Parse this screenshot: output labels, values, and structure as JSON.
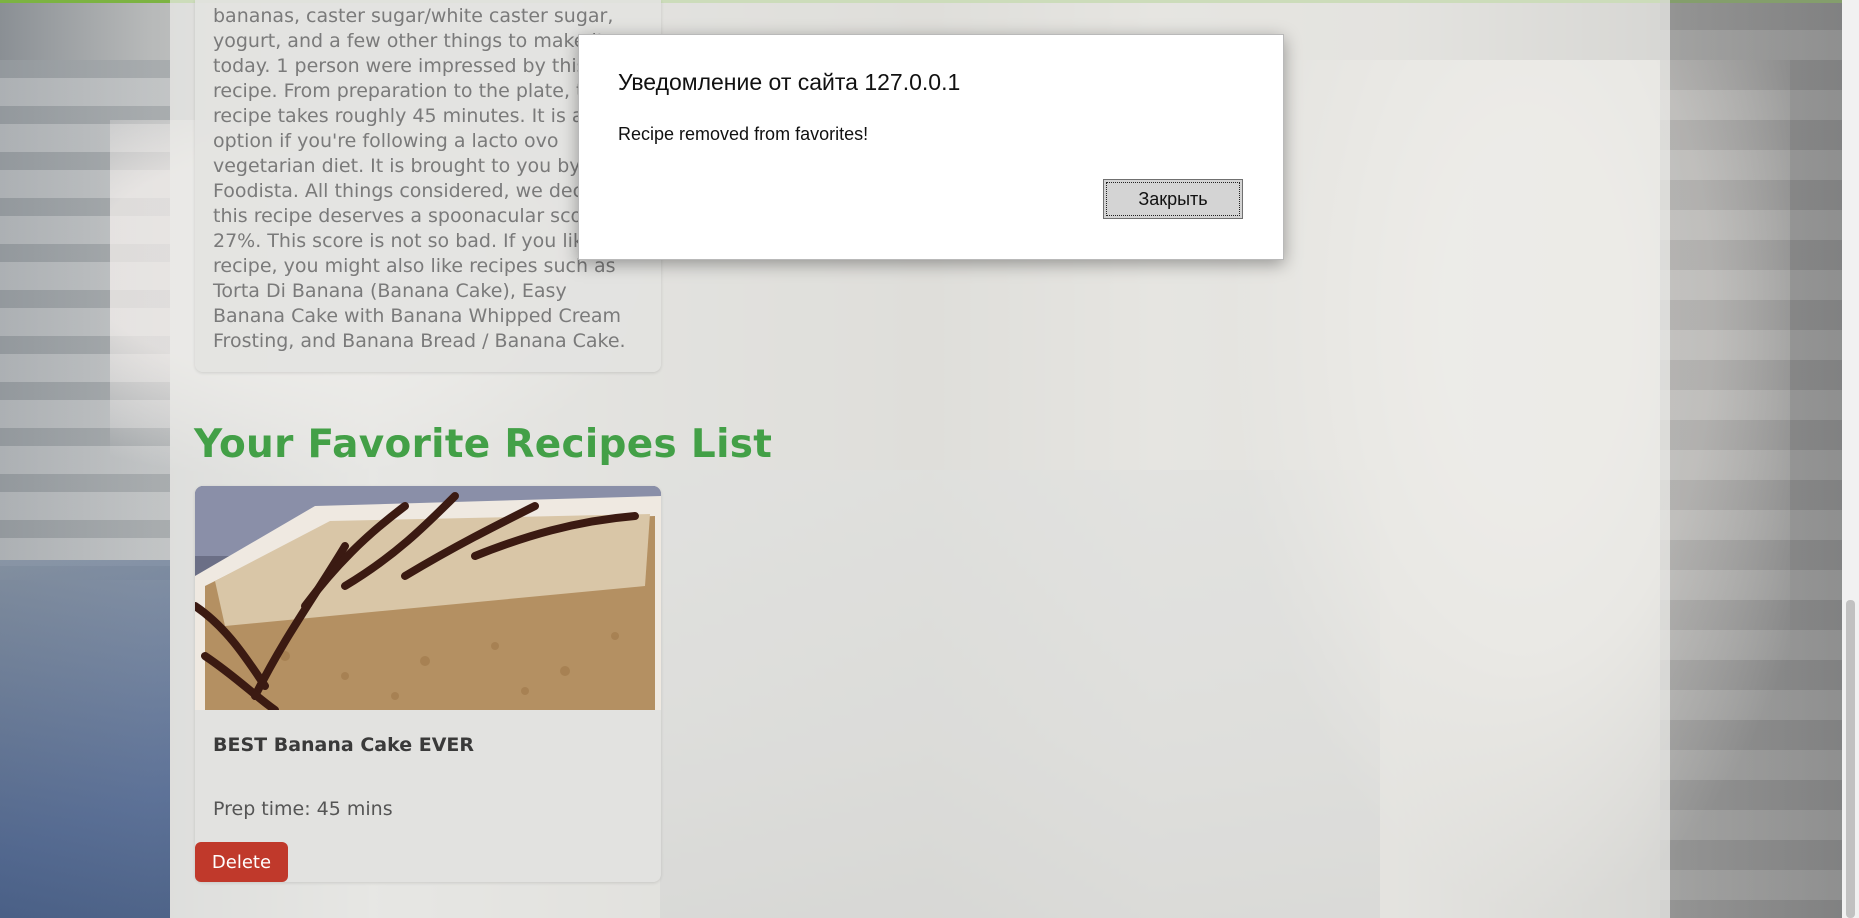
{
  "recipe_summary": {
    "text": "bananas, caster sugar/white caster sugar, yogurt, and a few other things to make it today. 1 person were impressed by this recipe. From preparation to the plate, this recipe takes roughly 45 minutes. It is a good option if you're following a lacto ovo vegetarian diet. It is brought to you by Foodista. All things considered, we decided this recipe deserves a spoonacular score of 27%. This score is not so bad. If you like this recipe, you might also like recipes such as Torta Di Banana (Banana Cake), Easy Banana Cake with Banana Whipped Cream Frosting, and Banana Bread / Banana Cake."
  },
  "favorites": {
    "title": "Your Favorite Recipes List",
    "items": [
      {
        "title": "BEST Banana Cake EVER",
        "prep_time": "Prep time: 45 mins",
        "delete_label": "Delete",
        "image_icon": "banana-cake-photo"
      }
    ]
  },
  "alert": {
    "title": "Уведомление от сайта 127.0.0.1",
    "message": "Recipe removed from favorites!",
    "close_label": "Закрыть"
  },
  "colors": {
    "accent_green": "#43a047",
    "delete_red": "#c0392b",
    "top_bar": "#7cb342"
  }
}
